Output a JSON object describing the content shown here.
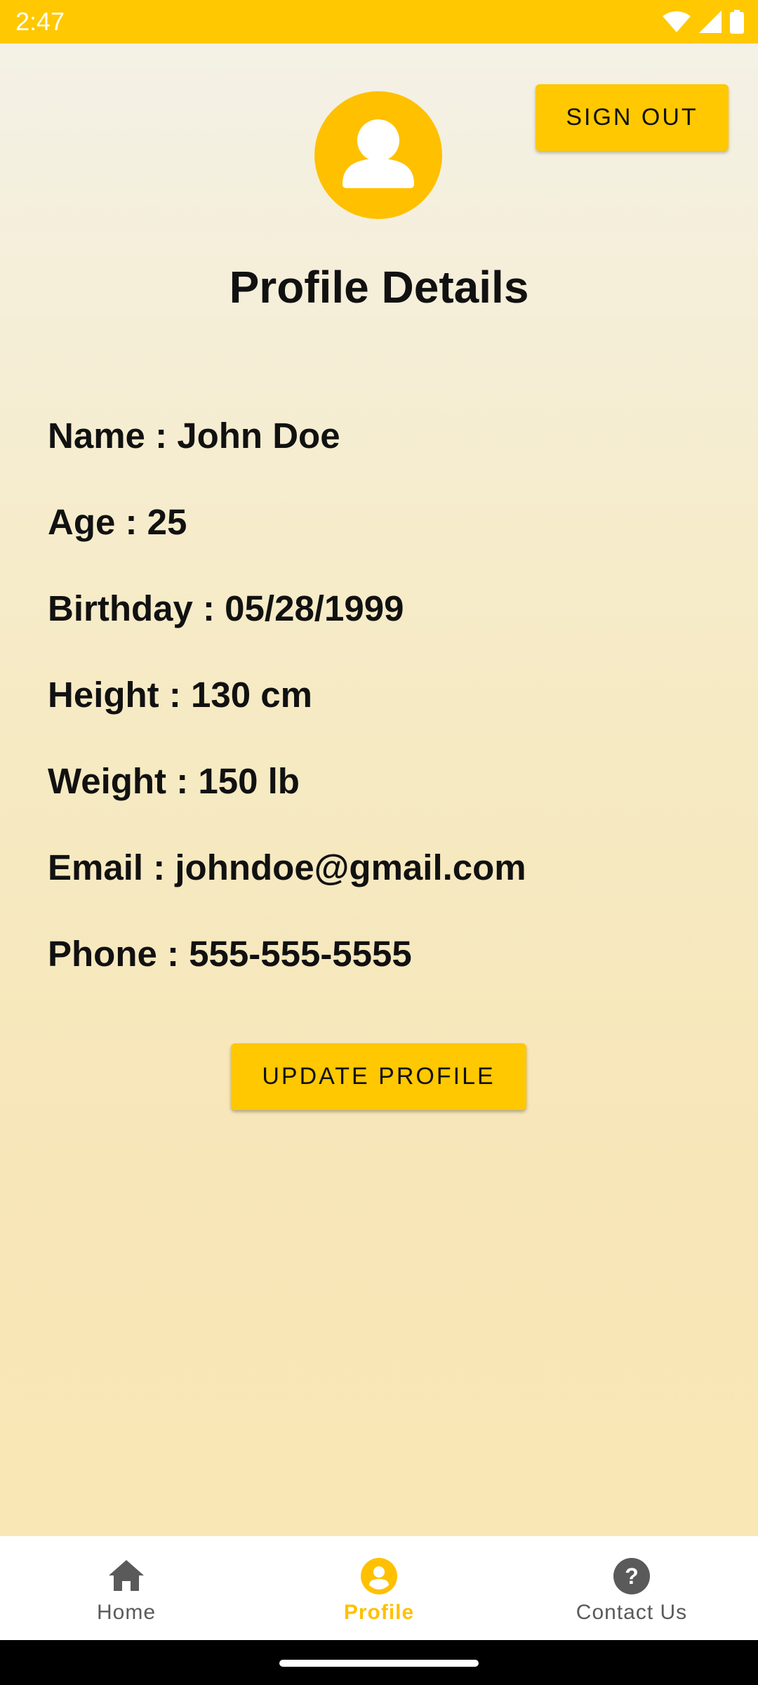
{
  "status_bar": {
    "time": "2:47",
    "icons": [
      "wifi-icon",
      "signal-icon",
      "battery-icon"
    ]
  },
  "header": {
    "sign_out_label": "SIGN OUT",
    "avatar_icon": "person-icon"
  },
  "main": {
    "title": "Profile Details",
    "details": [
      "Name : John Doe",
      "Age : 25",
      "Birthday : 05/28/1999",
      "Height : 130 cm",
      "Weight : 150 lb",
      "Email : johndoe@gmail.com",
      "Phone : 555-555-5555"
    ],
    "update_label": "UPDATE PROFILE"
  },
  "bottom_nav": {
    "items": [
      {
        "label": "Home",
        "icon": "home-icon",
        "active": false
      },
      {
        "label": "Profile",
        "icon": "profile-icon",
        "active": true
      },
      {
        "label": "Contact Us",
        "icon": "help-icon",
        "active": false
      }
    ]
  },
  "colors": {
    "accent": "#ffc800",
    "inactive": "#5a5a5a",
    "text": "#111111"
  }
}
